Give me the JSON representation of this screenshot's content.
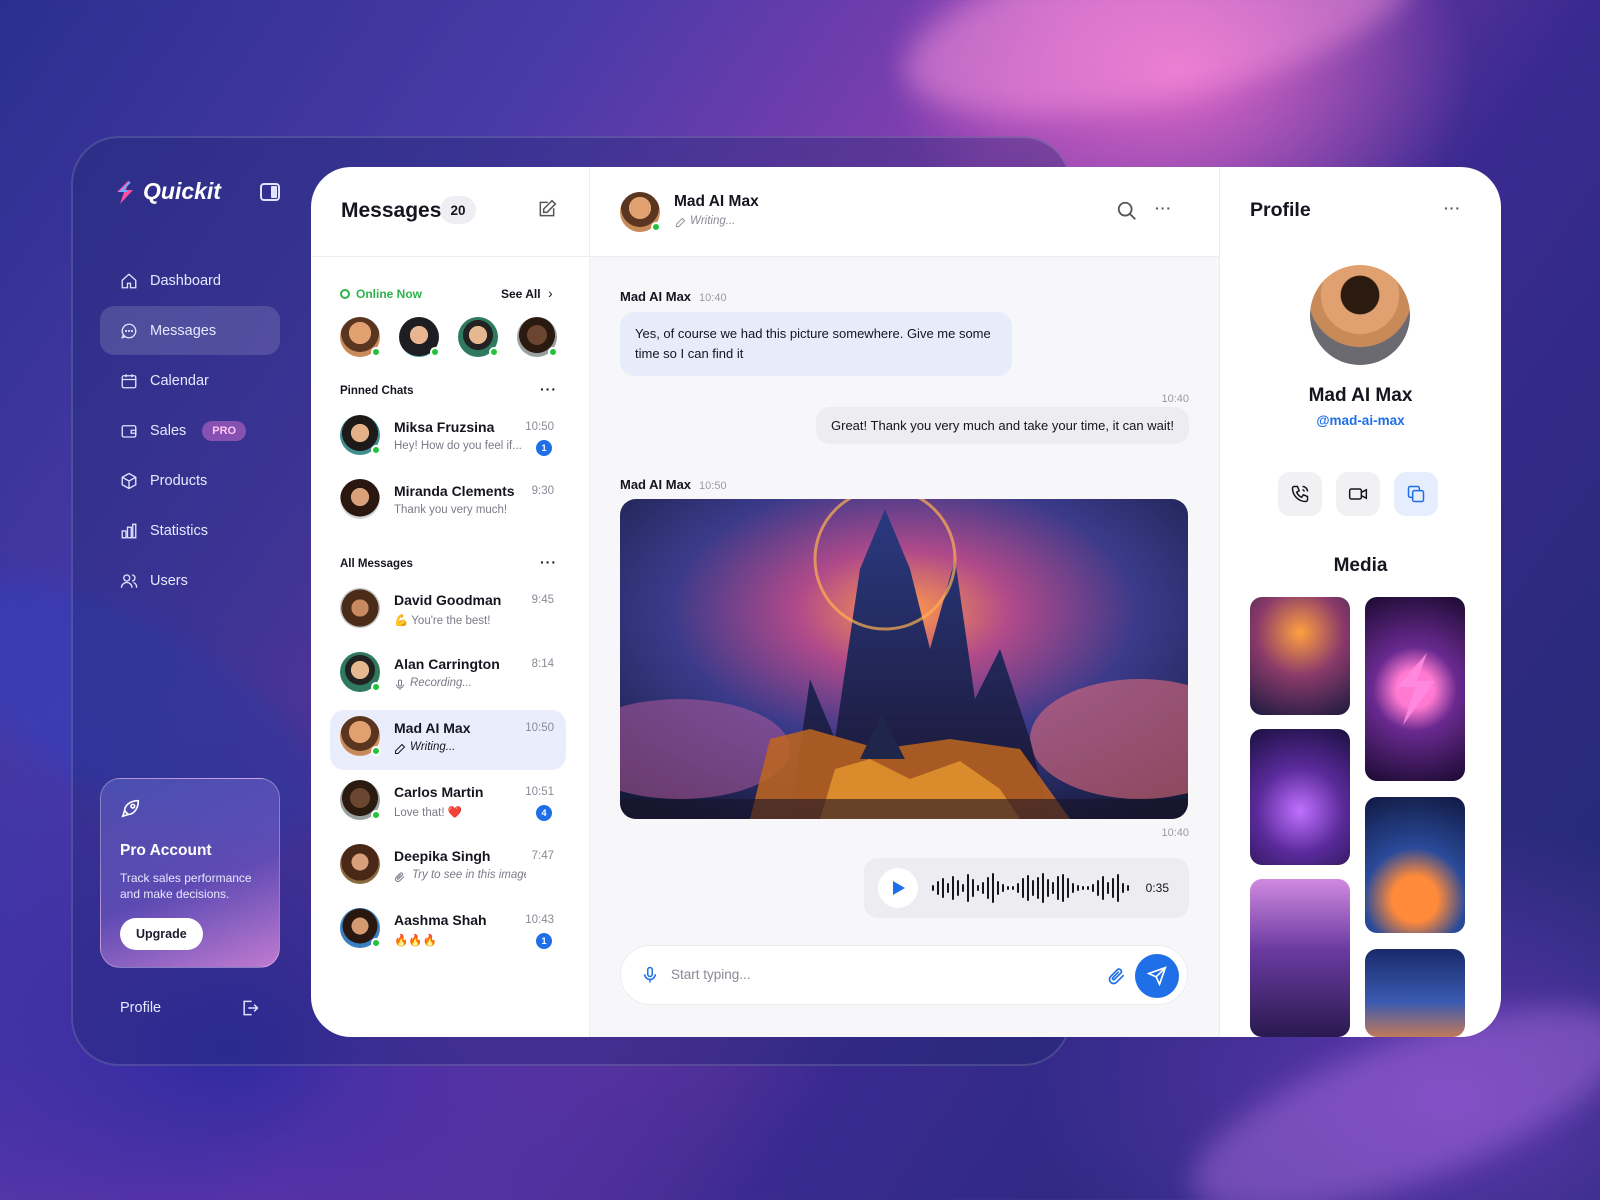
{
  "app": {
    "name": "Quickit"
  },
  "sidebar": {
    "items": [
      {
        "label": "Dashboard"
      },
      {
        "label": "Messages"
      },
      {
        "label": "Calendar"
      },
      {
        "label": "Sales",
        "badge": "PRO"
      },
      {
        "label": "Products"
      },
      {
        "label": "Statistics"
      },
      {
        "label": "Users"
      }
    ],
    "pro_card": {
      "title": "Pro Account",
      "text": "Track sales performance and make decisions.",
      "button": "Upgrade"
    },
    "profile_label": "Profile"
  },
  "messages": {
    "title": "Messages",
    "count": "20",
    "online_label": "Online Now",
    "see_all": "See All",
    "pinned_label": "Pinned Chats",
    "all_label": "All Messages",
    "pinned": [
      {
        "name": "Miksa Fruzsina",
        "preview": "Hey! How do you feel if...",
        "time": "10:50",
        "badge": "1"
      },
      {
        "name": "Miranda Clements",
        "preview": "Thank you very much!",
        "time": "9:30"
      }
    ],
    "all": [
      {
        "name": "David Goodman",
        "preview": "💪 You're the best!",
        "time": "9:45"
      },
      {
        "name": "Alan Carrington",
        "preview": "Recording...",
        "time": "8:14"
      },
      {
        "name": "Mad AI Max",
        "preview": "Writing...",
        "time": "10:50"
      },
      {
        "name": "Carlos Martin",
        "preview": "Love that! ❤️",
        "time": "10:51",
        "badge": "4"
      },
      {
        "name": "Deepika Singh",
        "preview": "Try to see in this image...",
        "time": "7:47"
      },
      {
        "name": "Aashma Shah",
        "preview": "🔥🔥🔥",
        "time": "10:43",
        "badge": "1"
      }
    ]
  },
  "chat": {
    "contact": "Mad AI Max",
    "status": "Writing...",
    "messages": [
      {
        "sender": "Mad AI Max",
        "time": "10:40",
        "text": "Yes, of course we had this picture somewhere. Give me some time so I can find it"
      },
      {
        "time": "10:40",
        "text": "Great! Thank you very much and take your time, it can wait!"
      },
      {
        "sender": "Mad AI Max",
        "time": "10:50"
      },
      {
        "time": "10:40",
        "duration": "0:35"
      }
    ],
    "input_placeholder": "Start typing..."
  },
  "profile": {
    "title": "Profile",
    "name": "Mad AI Max",
    "handle": "@mad-ai-max",
    "media_title": "Media"
  },
  "colors": {
    "accent": "#1f6fe6",
    "online": "#22c33b"
  }
}
